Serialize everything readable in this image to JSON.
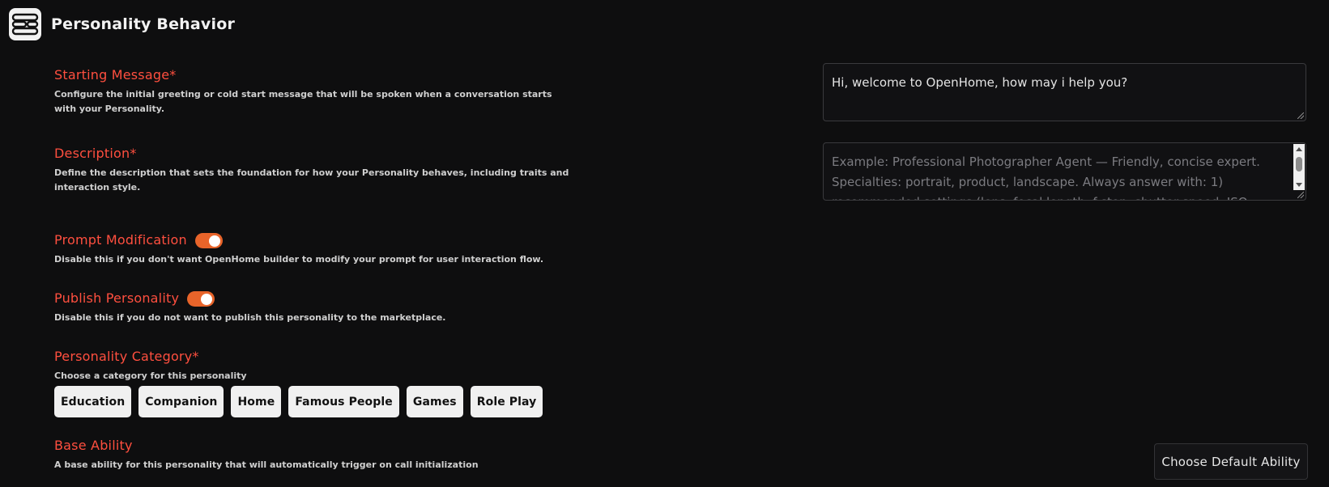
{
  "header": {
    "title": "Personality Behavior",
    "logo_icon": "openhome-logo-icon"
  },
  "colors": {
    "background": "#0e0e0f",
    "accent_red": "#ff4f3f",
    "toggle_orange": "#e8642a",
    "chip_bg": "#f0f0f0"
  },
  "starting_message": {
    "title": "Starting Message*",
    "description": "Configure the initial greeting or cold start message that will be spoken when a conversation starts with your Personality.",
    "value": "Hi, welcome to OpenHome, how may i help you?"
  },
  "description": {
    "title": "Description*",
    "description": "Define the description that sets the foundation for how your Personality behaves, including traits and interaction style.",
    "placeholder": "Example: Professional Photographer Agent — Friendly, concise expert. Specialties: portrait, product, landscape. Always answer with: 1) recommended settings (lens, focal length, f-stop, shutter speed, ISO, white"
  },
  "prompt_modification": {
    "title": "Prompt Modification",
    "description": "Disable this if you don't want OpenHome builder to modify your prompt for user interaction flow.",
    "enabled": true
  },
  "publish_personality": {
    "title": "Publish Personality",
    "description": "Disable this if you do not want to publish this personality to the marketplace.",
    "enabled": true
  },
  "personality_category": {
    "title": "Personality Category*",
    "description": "Choose a category for this personality",
    "options": [
      "Education",
      "Companion",
      "Home",
      "Famous People",
      "Games",
      "Role Play"
    ]
  },
  "base_ability": {
    "title": "Base Ability",
    "description": "A base ability for this personality that will automatically trigger on call initialization",
    "button_label": "Choose Default Ability"
  }
}
